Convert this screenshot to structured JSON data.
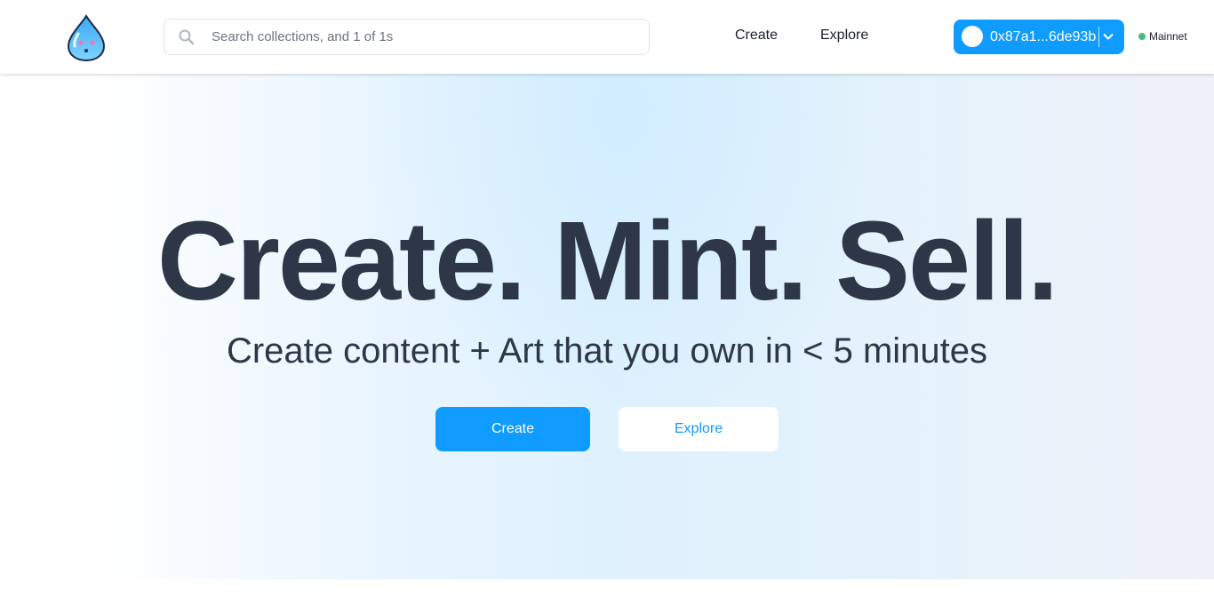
{
  "header": {
    "logo_icon": "water-drop-mascot-icon",
    "search": {
      "placeholder": "Search collections, and 1 of 1s",
      "icon": "search-icon"
    },
    "nav": [
      {
        "label": "Create"
      },
      {
        "label": "Explore"
      }
    ],
    "wallet": {
      "address": "0x87a1...6de93b",
      "avatar_icon": "avatar-circle-icon",
      "chevron_icon": "chevron-down-icon",
      "color": "#0f9bff"
    },
    "network": {
      "label": "Mainnet",
      "status_color": "#48bb78"
    }
  },
  "hero": {
    "headline": "Create. Mint. Sell.",
    "subtitle": "Create content + Art that you own in < 5 minutes",
    "primary_button": "Create",
    "secondary_button": "Explore"
  },
  "colors": {
    "accent": "#0f9bff",
    "text_dark": "#2d3748"
  }
}
